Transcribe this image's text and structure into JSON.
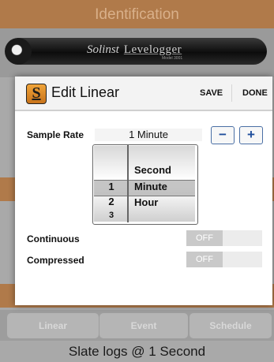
{
  "app": {
    "header_title": "Identification",
    "device": {
      "brand": "Solinst",
      "product": "Levelogger",
      "model": "Model 3001"
    },
    "tabs": [
      "Linear",
      "Event",
      "Schedule"
    ],
    "status": "Slate logs @  1 Second"
  },
  "dialog": {
    "icon_letter": "S",
    "title": "Edit Linear",
    "save_label": "SAVE",
    "done_label": "DONE",
    "sample_rate": {
      "label": "Sample Rate",
      "value": "1 Minute",
      "minus": "−",
      "plus": "+"
    },
    "picker": {
      "numbers": [
        "",
        "1",
        "2",
        "3"
      ],
      "units": [
        "Second",
        "Minute",
        "Hour"
      ],
      "selected_number": "1",
      "selected_unit": "Minute"
    },
    "continuous": {
      "label": "Continuous",
      "state": "OFF"
    },
    "compressed": {
      "label": "Compressed",
      "state": "OFF"
    }
  }
}
